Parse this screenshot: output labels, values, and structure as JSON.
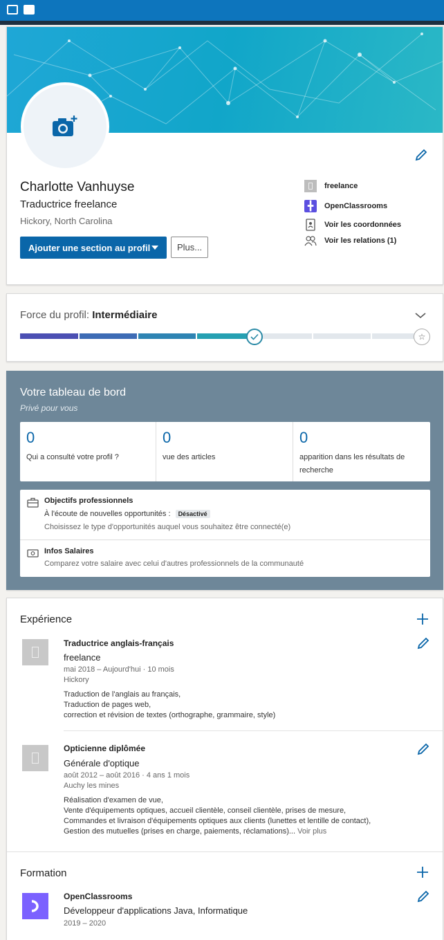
{
  "profile": {
    "name": "Charlotte Vanhuyse",
    "headline": "Traductrice freelance",
    "location": "Hickory, North Carolina",
    "primary_button": "Ajouter une section au profil",
    "more_button": "Plus...",
    "side": [
      {
        "label": "freelance",
        "icon": "building-icon"
      },
      {
        "label": "OpenClassrooms",
        "icon": "openclassrooms-logo"
      },
      {
        "label": "Voir les coordonnées",
        "icon": "contact-card-icon"
      },
      {
        "label": "Voir les relations (1)",
        "icon": "people-icon"
      }
    ]
  },
  "strength": {
    "label": "Force du profil:",
    "level": "Intermédiaire",
    "progress_steps_total": 7,
    "progress_steps_done": 4
  },
  "dashboard": {
    "title": "Votre tableau de bord",
    "subtitle": "Privé pour vous",
    "stats": [
      {
        "value": "0",
        "label": "Qui a consulté votre profil ?"
      },
      {
        "value": "0",
        "label": "vue des articles"
      },
      {
        "value": "0",
        "label": "apparition dans les résultats de recherche"
      }
    ],
    "goals": {
      "title": "Objectifs professionnels",
      "text": "À l'écoute de nouvelles opportunités :",
      "badge": "Désactivé",
      "sub": "Choisissez le type d'opportunités auquel vous souhaitez être connecté(e)"
    },
    "salary": {
      "title": "Infos Salaires",
      "sub": "Comparez votre salaire avec celui d'autres professionnels de la communauté"
    }
  },
  "experience": {
    "title": "Expérience",
    "items": [
      {
        "title": "Traductrice anglais-français",
        "company": "freelance",
        "dates": "mai 2018 – Aujourd'hui · 10 mois",
        "place": "Hickory",
        "desc": [
          "Traduction de l'anglais au français,",
          "Traduction de pages web,",
          "correction et révision de textes (orthographe, grammaire, style)"
        ]
      },
      {
        "title": "Opticienne diplômée",
        "company": "Générale d'optique",
        "dates": "août 2012 – août 2016 · 4 ans 1 mois",
        "place": "Auchy les mines",
        "desc": [
          "Réalisation d'examen de vue,",
          "Vente d'équipements optiques, accueil clientèle, conseil clientèle, prises de mesure,",
          "Commandes et livraison d'équipements optiques aux clients (lunettes et lentille de contact),",
          "Gestion des mutuelles (prises en charge, paiements, réclamations)..."
        ],
        "more": "Voir plus"
      }
    ]
  },
  "formation": {
    "title": "Formation",
    "items": [
      {
        "school": "OpenClassrooms",
        "degree": "Développeur d'applications Java, Informatique",
        "dates": "2019 – 2020"
      }
    ]
  },
  "colors": {
    "accent": "#0a66a9",
    "dashboard_bg": "#6e8799",
    "banner": "#1fa7d6",
    "oc_purple": "#7b61ff"
  }
}
